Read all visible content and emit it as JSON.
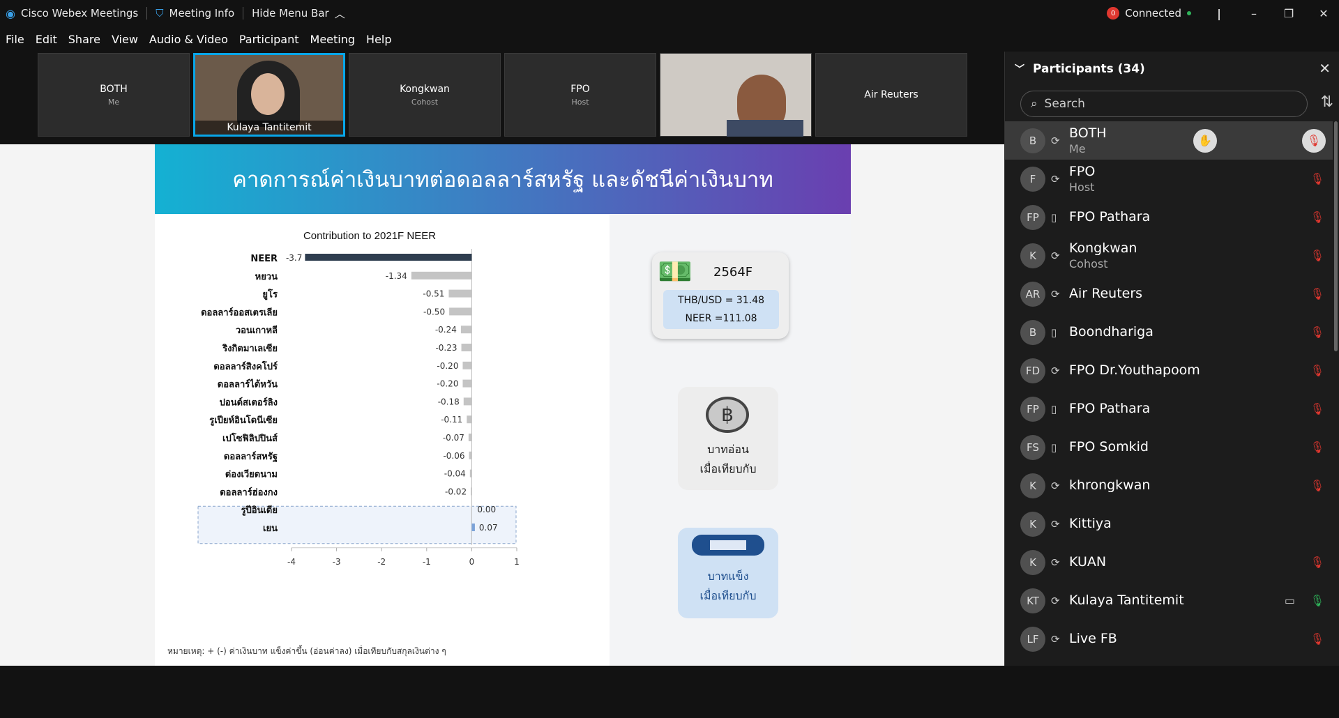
{
  "titlebar": {
    "app_name": "Cisco Webex Meetings",
    "meeting_info": "Meeting Info",
    "hide_menu": "Hide Menu Bar",
    "status_count": "0",
    "status": "Connected"
  },
  "menu": [
    "File",
    "Edit",
    "Share",
    "View",
    "Audio & Video",
    "Participant",
    "Meeting",
    "Help"
  ],
  "video_tiles": [
    {
      "name": "BOTH",
      "role": "Me",
      "video": false
    },
    {
      "name": "Kulaya Tantitemit",
      "role": "",
      "video": true,
      "active": true
    },
    {
      "name": "Kongkwan",
      "role": "Cohost",
      "video": false
    },
    {
      "name": "FPO",
      "role": "Host",
      "video": false
    },
    {
      "name": "",
      "role": "",
      "video": true
    },
    {
      "name": "Air Reuters",
      "role": "",
      "video": false
    }
  ],
  "slide": {
    "title": "คาดการณ์ค่าเงินบาทต่อดอลลาร์สหรัฐ และดัชนีค่าเงินบาท",
    "note": "หมายเหตุ: + (-) ค่าเงินบาท แข็งค่าขึ้น (อ่อนค่าลง) เมื่อเทียบกับสกุลเงินต่าง ๆ",
    "card_year": "2564F",
    "card_thb": "THB/USD = 31.48",
    "card_neer": "NEER =111.08",
    "weak_line1": "บาทอ่อน",
    "weak_line2": "เมื่อเทียบกับ",
    "strong_line1": "บาทแข็ง",
    "strong_line2": "เมื่อเทียบกับ",
    "colors": {
      "neer": "#2e3d4f",
      "negative": "#c4c4c4",
      "positive": "#7ba2d8",
      "weak_text": "#222222",
      "strong_text": "#1f4f8e"
    }
  },
  "chart_data": {
    "type": "bar",
    "orientation": "horizontal",
    "title": "Contribution to 2021F NEER",
    "categories": [
      "NEER",
      "หยวน",
      "ยูโร",
      "ดอลลาร์ออสเตรเลีย",
      "วอนเกาหลี",
      "ริงกิตมาเลเซีย",
      "ดอลลาร์สิงคโปร์",
      "ดอลลาร์ไต้หวัน",
      "ปอนด์สเตอร์ลิง",
      "รูเปียห์อินโดนีเซีย",
      "เปโซฟิลิปปินส์",
      "ดอลลาร์สหรัฐ",
      "ด่องเวียดนาม",
      "ดอลลาร์ฮ่องกง",
      "รูปีอินเดีย",
      "เยน"
    ],
    "values": [
      -3.7,
      -1.34,
      -0.51,
      -0.5,
      -0.24,
      -0.23,
      -0.2,
      -0.2,
      -0.18,
      -0.11,
      -0.07,
      -0.06,
      -0.04,
      -0.02,
      0.0,
      0.07
    ],
    "value_labels": [
      "-3.7",
      "-1.34",
      "-0.51",
      "-0.50",
      "-0.24",
      "-0.23",
      "-0.20",
      "-0.20",
      "-0.18",
      "-0.11",
      "-0.07",
      "-0.06",
      "-0.04",
      "-0.02",
      "0.00",
      "0.07"
    ],
    "xlim": [
      -4,
      1
    ],
    "xticks": [
      "-4",
      "-3",
      "-2",
      "-1",
      "0",
      "1"
    ],
    "highlight_categories": [
      "รูปีอินเดีย",
      "เยน"
    ]
  },
  "sidebar": {
    "title": "Participants (34)",
    "search_placeholder": "Search",
    "participants": [
      {
        "initials": "B",
        "name": "BOTH",
        "role": "Me",
        "device": "headset",
        "mic": "muted",
        "me": true,
        "raised": true
      },
      {
        "initials": "F",
        "name": "FPO",
        "role": "Host",
        "device": "headset",
        "mic": "muted"
      },
      {
        "initials": "FP",
        "name": "FPO Pathara",
        "role": "",
        "device": "phone",
        "mic": "muted"
      },
      {
        "initials": "K",
        "name": "Kongkwan",
        "role": "Cohost",
        "device": "headset",
        "mic": "muted"
      },
      {
        "initials": "AR",
        "name": "Air Reuters",
        "role": "",
        "device": "headset",
        "mic": "muted"
      },
      {
        "initials": "B",
        "name": "Boondhariga",
        "role": "",
        "device": "phone",
        "mic": "muted"
      },
      {
        "initials": "FD",
        "name": "FPO Dr.Youthapoom",
        "role": "",
        "device": "headset",
        "mic": "muted"
      },
      {
        "initials": "FP",
        "name": "FPO Pathara",
        "role": "",
        "device": "phone",
        "mic": "muted"
      },
      {
        "initials": "FS",
        "name": "FPO Somkid",
        "role": "",
        "device": "phone",
        "mic": "muted"
      },
      {
        "initials": "K",
        "name": "khrongkwan",
        "role": "",
        "device": "headset",
        "mic": "muted"
      },
      {
        "initials": "K",
        "name": "Kittiya",
        "role": "",
        "device": "headset",
        "mic": "none"
      },
      {
        "initials": "K",
        "name": "KUAN",
        "role": "",
        "device": "headset",
        "mic": "muted"
      },
      {
        "initials": "KT",
        "name": "Kulaya Tantitemit",
        "role": "",
        "device": "headset",
        "mic": "on",
        "camera": true
      },
      {
        "initials": "LF",
        "name": "Live FB",
        "role": "",
        "device": "headset",
        "mic": "muted"
      }
    ]
  }
}
